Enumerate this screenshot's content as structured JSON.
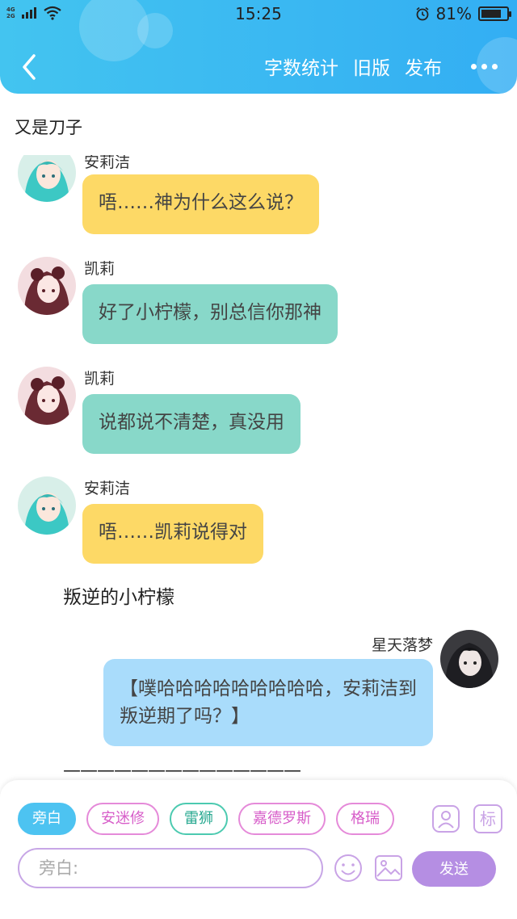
{
  "status_bar": {
    "network_top": "4G",
    "network_bottom": "2G",
    "time": "15:25",
    "battery_percent": "81%",
    "battery_level": 0.81
  },
  "header": {
    "actions": [
      "字数统计",
      "旧版",
      "发布"
    ],
    "background_color": "#3bb9f2"
  },
  "document": {
    "title": "又是刀子"
  },
  "messages": [
    {
      "sender": "安莉洁",
      "text": "唔……神为什么这么说？",
      "color": "#fdd966"
    },
    {
      "sender": "凯莉",
      "text": "好了小柠檬，别总信你那神",
      "color": "#88d8c9"
    },
    {
      "sender": "凯莉",
      "text": "说都说不清楚，真没用",
      "color": "#88d8c9"
    },
    {
      "sender": "安莉洁",
      "text": "唔……凯莉说得对",
      "color": "#fdd966"
    }
  ],
  "narration": "叛逆的小柠檬",
  "self_message": {
    "sender": "星天落梦",
    "text": "【噗哈哈哈哈哈哈哈哈哈，安莉洁到叛逆期了吗？】",
    "color": "#a9dcfb"
  },
  "divider": "——————————————",
  "composer": {
    "roles": [
      "旁白",
      "安迷修",
      "雷狮",
      "嘉德罗斯",
      "格瑞"
    ],
    "active_role": "旁白",
    "tag_label": "标",
    "input_placeholder": "旁白:",
    "send_label": "发送"
  }
}
